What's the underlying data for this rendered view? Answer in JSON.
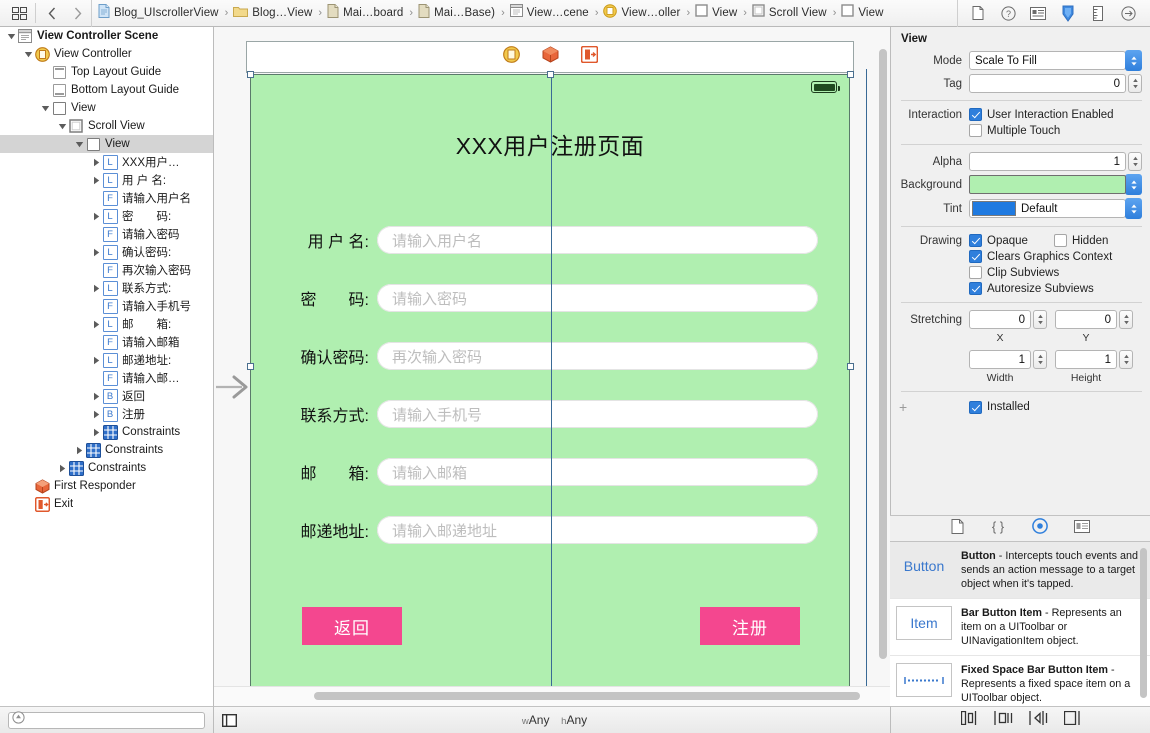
{
  "topbar": {
    "left_icons": [
      {
        "name": "editor-layout-icon",
        "glyph": "grid"
      },
      {
        "name": "back-chevron-icon",
        "glyph": "‹"
      },
      {
        "name": "forward-chevron-icon",
        "glyph": "›"
      }
    ],
    "breadcrumbs": [
      {
        "label": "Blog_UIscrollerView",
        "icon": "project-icon"
      },
      {
        "label": "Blog…View",
        "icon": "folder-icon"
      },
      {
        "label": "Mai…board",
        "icon": "storyboard-file-icon"
      },
      {
        "label": "Mai…Base)",
        "icon": "storyboard-file-icon"
      },
      {
        "label": "View…cene",
        "icon": "scene-icon"
      },
      {
        "label": "View…oller",
        "icon": "view-controller-icon"
      },
      {
        "label": "View",
        "icon": "view-icon"
      },
      {
        "label": "Scroll View",
        "icon": "scroll-view-icon"
      },
      {
        "label": "View",
        "icon": "view-icon"
      }
    ],
    "inspector_tabs": [
      {
        "name": "file-inspector-tab",
        "selected": false
      },
      {
        "name": "quick-help-inspector-tab",
        "selected": false
      },
      {
        "name": "identity-inspector-tab",
        "selected": false
      },
      {
        "name": "attributes-inspector-tab",
        "selected": true
      },
      {
        "name": "size-inspector-tab",
        "selected": false
      },
      {
        "name": "connections-inspector-tab",
        "selected": false
      }
    ]
  },
  "outline": {
    "items": [
      {
        "label": "View Controller Scene",
        "depth": 0,
        "icon": "scene-icon",
        "disclosure": "open",
        "bold": true,
        "selected": false
      },
      {
        "label": "View Controller",
        "depth": 1,
        "icon": "view-controller-icon",
        "disclosure": "open",
        "bold": false,
        "selected": false
      },
      {
        "label": "Top Layout Guide",
        "depth": 2,
        "icon": "top-layout-guide-icon",
        "disclosure": "none",
        "bold": false,
        "selected": false
      },
      {
        "label": "Bottom Layout Guide",
        "depth": 2,
        "icon": "bottom-layout-guide-icon",
        "disclosure": "none",
        "bold": false,
        "selected": false
      },
      {
        "label": "View",
        "depth": 2,
        "icon": "view-icon",
        "disclosure": "open",
        "bold": false,
        "selected": false
      },
      {
        "label": "Scroll View",
        "depth": 3,
        "icon": "scroll-view-icon",
        "disclosure": "open",
        "bold": false,
        "selected": false
      },
      {
        "label": "View",
        "depth": 4,
        "icon": "view-icon",
        "disclosure": "open",
        "bold": false,
        "selected": true
      },
      {
        "label": "XXX用户…",
        "depth": 5,
        "icon": "label-icon",
        "disclosure": "closed",
        "bold": false,
        "selected": false
      },
      {
        "label": "用 户 名:",
        "depth": 5,
        "icon": "label-icon",
        "disclosure": "closed",
        "bold": false,
        "selected": false
      },
      {
        "label": "请输入用户名",
        "depth": 5,
        "icon": "textfield-icon",
        "disclosure": "none",
        "bold": false,
        "selected": false
      },
      {
        "label": "密　　码:",
        "depth": 5,
        "icon": "label-icon",
        "disclosure": "closed",
        "bold": false,
        "selected": false
      },
      {
        "label": "请输入密码",
        "depth": 5,
        "icon": "textfield-icon",
        "disclosure": "none",
        "bold": false,
        "selected": false
      },
      {
        "label": "确认密码:",
        "depth": 5,
        "icon": "label-icon",
        "disclosure": "closed",
        "bold": false,
        "selected": false
      },
      {
        "label": "再次输入密码",
        "depth": 5,
        "icon": "textfield-icon",
        "disclosure": "none",
        "bold": false,
        "selected": false
      },
      {
        "label": "联系方式:",
        "depth": 5,
        "icon": "label-icon",
        "disclosure": "closed",
        "bold": false,
        "selected": false
      },
      {
        "label": "请输入手机号",
        "depth": 5,
        "icon": "textfield-icon",
        "disclosure": "none",
        "bold": false,
        "selected": false
      },
      {
        "label": "邮　　箱:",
        "depth": 5,
        "icon": "label-icon",
        "disclosure": "closed",
        "bold": false,
        "selected": false
      },
      {
        "label": "请输入邮箱",
        "depth": 5,
        "icon": "textfield-icon",
        "disclosure": "none",
        "bold": false,
        "selected": false
      },
      {
        "label": "邮递地址:",
        "depth": 5,
        "icon": "label-icon",
        "disclosure": "closed",
        "bold": false,
        "selected": false
      },
      {
        "label": "请输入邮…",
        "depth": 5,
        "icon": "textfield-icon",
        "disclosure": "none",
        "bold": false,
        "selected": false
      },
      {
        "label": "返回",
        "depth": 5,
        "icon": "button-icon",
        "disclosure": "closed",
        "bold": false,
        "selected": false
      },
      {
        "label": "注册",
        "depth": 5,
        "icon": "button-icon",
        "disclosure": "closed",
        "bold": false,
        "selected": false
      },
      {
        "label": "Constraints",
        "depth": 5,
        "icon": "constraints-icon",
        "disclosure": "closed",
        "bold": false,
        "selected": false
      },
      {
        "label": "Constraints",
        "depth": 4,
        "icon": "constraints-icon",
        "disclosure": "closed",
        "bold": false,
        "selected": false
      },
      {
        "label": "Constraints",
        "depth": 3,
        "icon": "constraints-icon",
        "disclosure": "closed",
        "bold": false,
        "selected": false
      },
      {
        "label": "First Responder",
        "depth": 1,
        "icon": "first-responder-icon",
        "disclosure": "none",
        "bold": false,
        "selected": false
      },
      {
        "label": "Exit",
        "depth": 1,
        "icon": "exit-icon",
        "disclosure": "none",
        "bold": false,
        "selected": false
      }
    ],
    "filter_placeholder": ""
  },
  "canvas": {
    "dock_icons": [
      {
        "name": "view-controller-dock-icon"
      },
      {
        "name": "first-responder-dock-icon"
      },
      {
        "name": "exit-dock-icon"
      }
    ],
    "entry_point": "storyboard-entry-point-arrow",
    "background_color": "#b0efb0",
    "title": "XXX用户注册页面",
    "fields": [
      {
        "label": "用 户 名:",
        "placeholder": "请输入用户名"
      },
      {
        "label": "密　　码:",
        "placeholder": "请输入密码"
      },
      {
        "label": "确认密码:",
        "placeholder": "再次输入密码"
      },
      {
        "label": "联系方式:",
        "placeholder": "请输入手机号"
      },
      {
        "label": "邮　　箱:",
        "placeholder": "请输入邮箱"
      },
      {
        "label": "邮递地址:",
        "placeholder": "请输入邮递地址"
      }
    ],
    "buttons": [
      {
        "label": "返回",
        "color": "#f4478f"
      },
      {
        "label": "注册",
        "color": "#f4478f"
      }
    ]
  },
  "inspector": {
    "section_title": "View",
    "mode_label": "Mode",
    "mode_value": "Scale To Fill",
    "tag_label": "Tag",
    "tag_value": "0",
    "interaction_label": "Interaction",
    "user_interaction_enabled": {
      "label": "User Interaction Enabled",
      "checked": true
    },
    "multiple_touch": {
      "label": "Multiple Touch",
      "checked": false
    },
    "alpha_label": "Alpha",
    "alpha_value": "1",
    "background_label": "Background",
    "background_color": "#b0efb0",
    "tint_label": "Tint",
    "tint_value": "Default",
    "tint_color": "#1f7ae0",
    "drawing_label": "Drawing",
    "opaque": {
      "label": "Opaque",
      "checked": true
    },
    "hidden": {
      "label": "Hidden",
      "checked": false
    },
    "clears_graphics_context": {
      "label": "Clears Graphics Context",
      "checked": true
    },
    "clip_subviews": {
      "label": "Clip Subviews",
      "checked": false
    },
    "autoresize_subviews": {
      "label": "Autoresize Subviews",
      "checked": true
    },
    "stretching_label": "Stretching",
    "stretch_x": {
      "value": "0",
      "caption": "X"
    },
    "stretch_y": {
      "value": "0",
      "caption": "Y"
    },
    "stretch_w": {
      "value": "1",
      "caption": "Width"
    },
    "stretch_h": {
      "value": "1",
      "caption": "Height"
    },
    "installed": {
      "label": "Installed",
      "checked": true
    },
    "add_variation_label": "+"
  },
  "library": {
    "tabs": [
      {
        "name": "file-template-library-tab",
        "selected": false
      },
      {
        "name": "code-snippet-library-tab",
        "selected": false
      },
      {
        "name": "object-library-tab",
        "selected": true
      },
      {
        "name": "media-library-tab",
        "selected": false
      }
    ],
    "items": [
      {
        "thumb": "Button",
        "thumb_style": "plain",
        "title": "Button",
        "desc": " - Intercepts touch events and sends an action message to a target object when it's tapped.",
        "selected": true
      },
      {
        "thumb": "Item",
        "thumb_style": "boxed",
        "title": "Bar Button Item",
        "desc": " - Represents an item on a UIToolbar or UINavigationItem object.",
        "selected": false
      },
      {
        "thumb": "dots",
        "thumb_style": "boxed",
        "title": "Fixed Space Bar Button Item",
        "desc": " - Represents a fixed space item on a UIToolbar object.",
        "selected": false
      }
    ]
  },
  "bottombar": {
    "size_class_w": "Any",
    "size_class_w_prefix": "w",
    "size_class_h": "Any",
    "size_class_h_prefix": "h",
    "left_toggle": "document-outline-toggle",
    "autolayout_icons": [
      {
        "name": "align-icon"
      },
      {
        "name": "pin-icon"
      },
      {
        "name": "resolve-autolayout-issues-icon"
      },
      {
        "name": "resizing-behavior-icon"
      }
    ]
  }
}
